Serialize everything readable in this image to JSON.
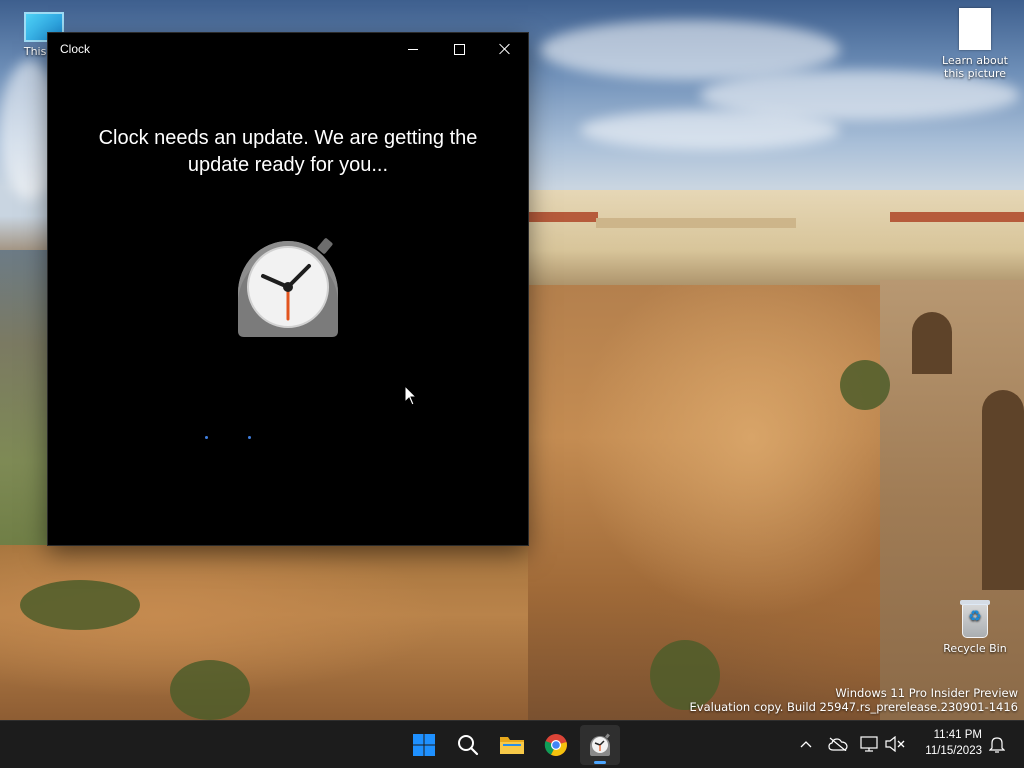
{
  "window": {
    "title": "Clock",
    "message": "Clock needs an update. We are getting the update ready for you...",
    "app_icon": "clock-app-icon",
    "controls": {
      "minimize_icon": "minimize-icon",
      "maximize_icon": "maximize-icon",
      "close_icon": "close-icon"
    }
  },
  "desktop": {
    "icons": [
      {
        "label": "This PC",
        "icon": "monitor-icon"
      },
      {
        "label": "Learn about this picture",
        "icon": "document-icon"
      },
      {
        "label": "Recycle Bin",
        "icon": "recycle-bin-icon"
      }
    ],
    "watermark": {
      "line1": "Windows 11 Pro Insider Preview",
      "line2": "Evaluation copy. Build 25947.rs_prerelease.230901-1416"
    }
  },
  "taskbar": {
    "apps": [
      {
        "name": "Start",
        "icon": "windows-start-icon"
      },
      {
        "name": "Search",
        "icon": "search-icon"
      },
      {
        "name": "File Explorer",
        "icon": "folder-icon"
      },
      {
        "name": "Google Chrome",
        "icon": "chrome-icon"
      },
      {
        "name": "Clock",
        "icon": "clock-icon",
        "active": true
      }
    ],
    "tray": {
      "icons": [
        "chevron-up-icon",
        "onedrive-icon",
        "network-icon",
        "volume-muted-icon",
        "notification-bell-icon"
      ],
      "time": "11:41 PM",
      "date": "11/15/2023"
    }
  },
  "colors": {
    "taskbar_bg": "#1c1c1c",
    "window_bg": "#000000",
    "accent": "#4ca6ff",
    "start_blue": "#1e90ff",
    "clock_hand_red": "#e2541e"
  }
}
